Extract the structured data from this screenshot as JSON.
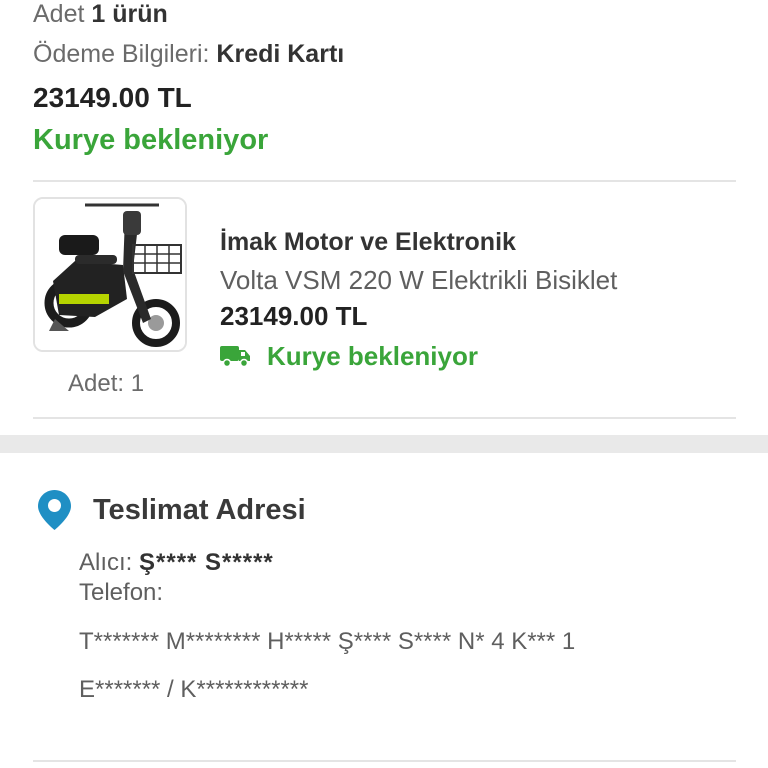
{
  "order_summary": {
    "quantity_label": "Adet",
    "quantity_value": "1 ürün",
    "payment_label": "Ödeme Bilgileri:",
    "payment_value": "Kredi Kartı",
    "total_price": "23149.00 TL",
    "status": "Kurye bekleniyor"
  },
  "product": {
    "seller": "İmak Motor ve Elektronik",
    "name": "Volta VSM 220 W Elektrikli Bisiklet",
    "price": "23149.00 TL",
    "status": "Kurye bekleniyor",
    "quantity_text": "Adet: 1",
    "status_icon": "delivery-truck-icon"
  },
  "delivery_address": {
    "title": "Teslimat Adresi",
    "icon": "location-pin-icon",
    "recipient_label": "Alıcı:",
    "recipient_name": "Ş****  S*****",
    "phone_label": "Telefon:",
    "address_line1": "T******* M******** H***** Ş**** S**** N* 4  K*** 1",
    "address_line2": "E******* / K************"
  },
  "colors": {
    "status_green": "#3aa53a",
    "pin_blue": "#1f8fc4",
    "divider": "#e4e4e4",
    "section_band": "#e9e9e9"
  }
}
